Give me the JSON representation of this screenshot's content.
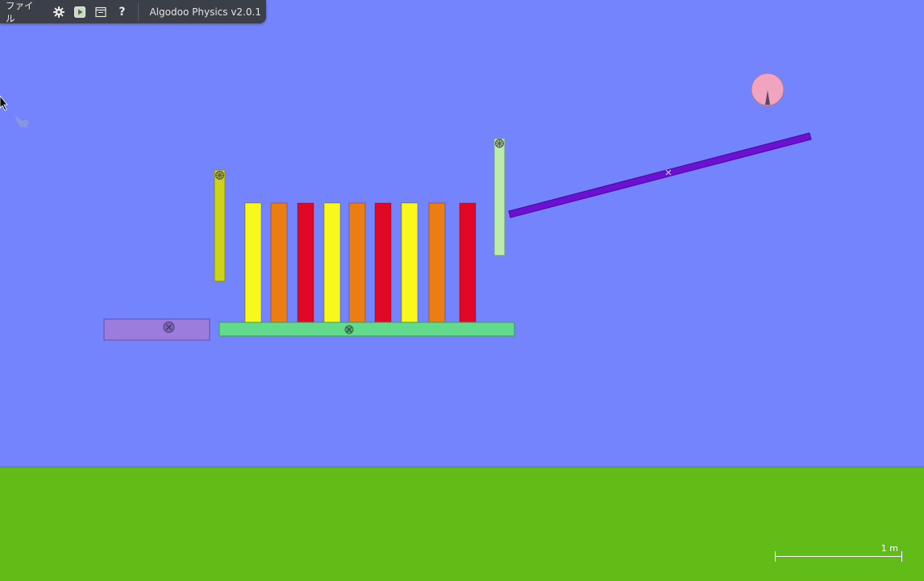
{
  "toolbar": {
    "file_label": "ファイル",
    "settings_icon": "gear-icon",
    "play_icon": "play-icon",
    "window_icon": "window-icon",
    "help_label": "?",
    "app_title": "Algodoo Physics v2.0.1"
  },
  "scene": {
    "scale_bar_label": "1 m",
    "colors": {
      "sky": "#7484fc",
      "ground": "#62bc18",
      "yellow": "#f8f81c",
      "orange": "#ec7c14",
      "red": "#e00824",
      "green_base": "#62dc8c",
      "purple_block": "#9c7cdc",
      "ramp": "#6c10d4",
      "ball": "#f0a4c0",
      "left_post": "#ccd41c",
      "right_post": "#bcecac"
    },
    "domino_colors": [
      "yellow",
      "orange",
      "red",
      "yellow",
      "orange",
      "red",
      "yellow",
      "orange",
      "red"
    ]
  }
}
